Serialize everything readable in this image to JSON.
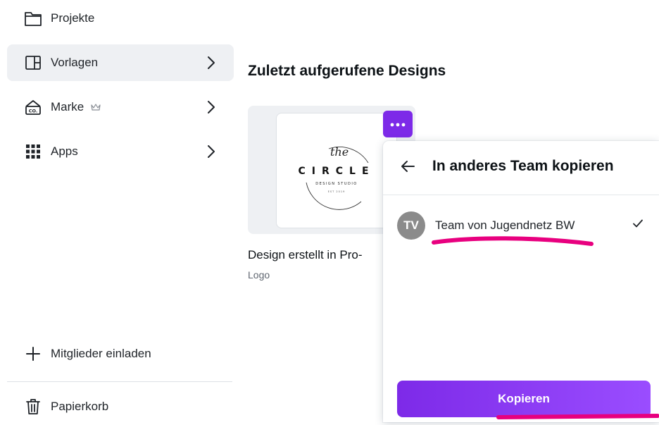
{
  "sidebar": {
    "items": [
      {
        "label": "Projekte",
        "icon": "folder-icon"
      },
      {
        "label": "Vorlagen",
        "icon": "template-icon"
      },
      {
        "label": "Marke",
        "icon": "brand-kit-icon"
      },
      {
        "label": "Apps",
        "icon": "apps-grid-icon"
      }
    ],
    "invite_label": "Mitglieder einladen",
    "trash_label": "Papierkorb"
  },
  "main": {
    "section_title": "Zuletzt aufgerufene Designs",
    "design": {
      "title": "Design erstellt in Pro-",
      "type": "Logo",
      "thumbnail": {
        "word": "CIRCLE",
        "the": "the",
        "tagline": "DESIGN STUDIO",
        "small": "EST 2019"
      }
    }
  },
  "panel": {
    "title": "In anderes Team kopieren",
    "team": {
      "initials": "TV",
      "name": "Team von Jugendnetz BW",
      "selected": true
    },
    "copy_label": "Kopieren"
  },
  "colors": {
    "accent": "#7d2ae8",
    "highlight_marker": "#e8007f",
    "active_bg": "#eef0f3"
  }
}
